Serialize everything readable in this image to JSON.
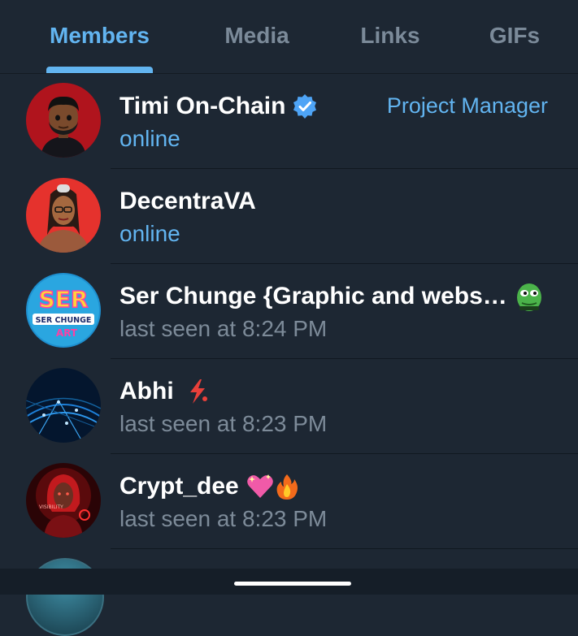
{
  "tabs": [
    {
      "label": "Members",
      "active": true
    },
    {
      "label": "Media",
      "active": false
    },
    {
      "label": "Links",
      "active": false
    },
    {
      "label": "GIFs",
      "active": false
    }
  ],
  "members": [
    {
      "name": "Timi On-Chain",
      "status": "online",
      "role": "Project Manager",
      "verified": true,
      "avatar": "cartoon-man-avatar"
    },
    {
      "name": "DecentraVA",
      "status": "online",
      "avatar": "cartoon-woman-avatar"
    },
    {
      "name": "Ser Chunge {Graphic and webs…",
      "status": "last seen at 8:24 PM",
      "emoji_status": "pepe-frog-icon",
      "avatar": "ser-chunge-art-logo-avatar",
      "avatar_text": [
        "SER",
        "SER CHUNGE",
        "ART"
      ]
    },
    {
      "name": "Abhi",
      "status": "last seen at 8:23 PM",
      "emoji_status": "lightning-bolt-icon",
      "avatar": "blue-network-avatar"
    },
    {
      "name": "Crypt_dee",
      "status": "last seen at 8:23 PM",
      "emoji_status": [
        "sparkling-heart-icon",
        "fire-icon"
      ],
      "avatar": "red-glow-woman-avatar",
      "avatar_text": "VISIBILITY"
    }
  ],
  "colors": {
    "background": "#1d2733",
    "accent": "#62b4f0",
    "secondary_text": "#7d8b99",
    "verified_badge": "#4ea4f6"
  }
}
